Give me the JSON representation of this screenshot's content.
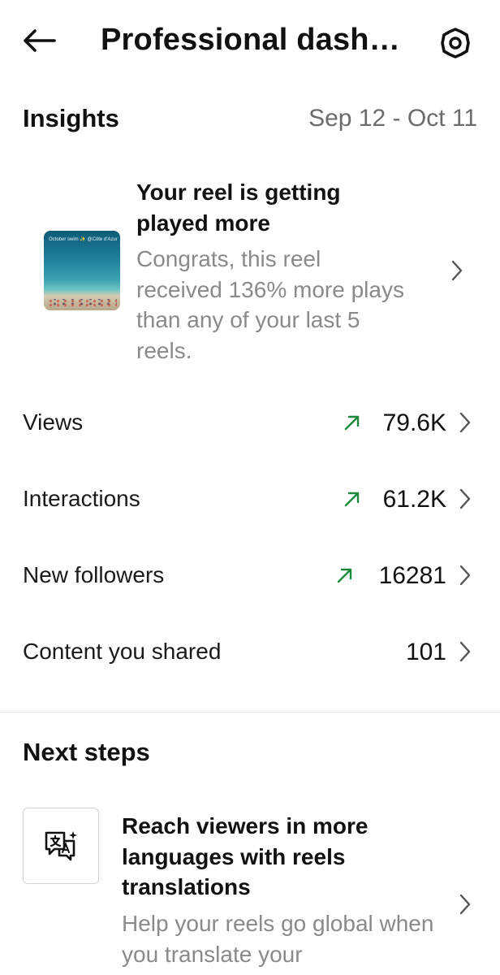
{
  "header": {
    "title": "Professional dash…",
    "back_icon": "arrow-left-icon",
    "settings_icon": "gear-icon"
  },
  "insights": {
    "title": "Insights",
    "date_range": "Sep 12 - Oct 11"
  },
  "highlight": {
    "thumbnail_caption": "October swim ✨ @Côte d'Azur",
    "title": "Your reel is getting played more",
    "body": "Congrats, this reel received 136% more plays than any of your last 5 reels."
  },
  "metrics": [
    {
      "label": "Views",
      "value": "79.6K",
      "trend": "up"
    },
    {
      "label": "Interactions",
      "value": "61.2K",
      "trend": "up"
    },
    {
      "label": "New followers",
      "value": "16281",
      "trend": "up"
    },
    {
      "label": "Content you shared",
      "value": "101",
      "trend": "none"
    }
  ],
  "next_steps": {
    "title": "Next steps",
    "item": {
      "icon": "translate-icon",
      "title": "Reach viewers in more languages with reels translations",
      "body": "Help your reels go global when you translate your"
    }
  },
  "colors": {
    "trend_up": "#1a8a3a",
    "muted_text": "#8a8a8a",
    "date_text": "#6b6b6b"
  }
}
